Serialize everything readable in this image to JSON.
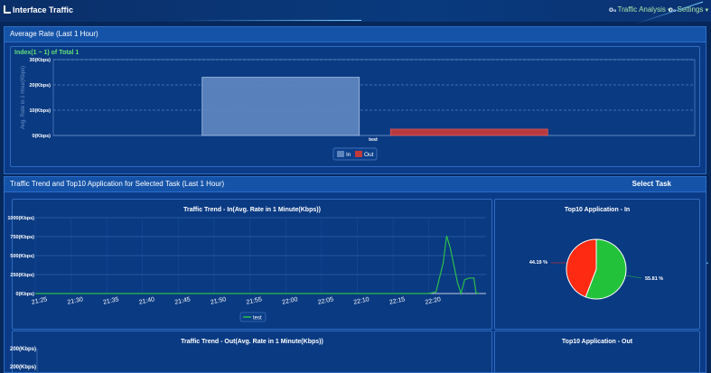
{
  "app": {
    "title": "Interface Traffic",
    "menu_analysis": "Traffic Analysis",
    "menu_settings": "Settings"
  },
  "avg_panel": {
    "title": "Average Rate (Last 1 Hour)",
    "index_label": "Index(1 ~ 1) of Total 1"
  },
  "trend_panel": {
    "title": "Traffic Trend and Top10 Application for Selected Task (Last 1 Hour)",
    "select_task": "Select Task"
  },
  "chart_data": [
    {
      "type": "bar",
      "ylabel": "Avg. Rate in 1 Hour(Kbps)",
      "categories": [
        "test"
      ],
      "series": [
        {
          "name": "In",
          "values": [
            23
          ]
        },
        {
          "name": "Out",
          "values": [
            2.5
          ]
        }
      ],
      "yticks": [
        "0(Kbps)",
        "10(Kbps)",
        "20(Kbps)",
        "30(Kbps)"
      ],
      "ylim": [
        0,
        30
      ],
      "legend": "bottom",
      "colors": [
        "#5d84bd",
        "#c23a3a"
      ]
    },
    {
      "type": "line",
      "title": "Traffic Trend - In(Avg. Rate in 1 Minute(Kbps))",
      "xticks": [
        "21:25",
        "21:30",
        "21:35",
        "21:40",
        "21:45",
        "21:50",
        "21:55",
        "22:00",
        "22:05",
        "22:10",
        "22:15",
        "22:20"
      ],
      "yticks": [
        "0(Kbps)",
        "250(Kbps)",
        "500(Kbps)",
        "750(Kbps)",
        "1000(Kbps)"
      ],
      "ylim": [
        0,
        1000
      ],
      "series": [
        {
          "name": "test",
          "color": "#2bbf4a",
          "points": [
            [
              0,
              0
            ],
            [
              10,
              0
            ],
            [
              20,
              0
            ],
            [
              30,
              0
            ],
            [
              40,
              0
            ],
            [
              50,
              0
            ],
            [
              55,
              0
            ],
            [
              56,
              20
            ],
            [
              57,
              400
            ],
            [
              57.5,
              760
            ],
            [
              58,
              600
            ],
            [
              59,
              150
            ],
            [
              59.5,
              0
            ],
            [
              60,
              180
            ],
            [
              60.6,
              205
            ],
            [
              61.3,
              205
            ],
            [
              61.6,
              10
            ],
            [
              62,
              0
            ]
          ]
        }
      ],
      "legend": "bottom"
    },
    {
      "type": "pie",
      "title": "Top10 Application - In",
      "slices": [
        {
          "label": "55.81 %",
          "value": 55.81,
          "color": "#22c33a"
        },
        {
          "label": "44.19 %",
          "value": 44.19,
          "color": "#ff2a12"
        }
      ]
    },
    {
      "type": "line",
      "title": "Traffic Trend - Out(Avg. Rate in 1 Minute(Kbps))",
      "yticks": [
        "200(Kbps)"
      ]
    },
    {
      "type": "pie",
      "title": "Top10 Application - Out"
    }
  ]
}
